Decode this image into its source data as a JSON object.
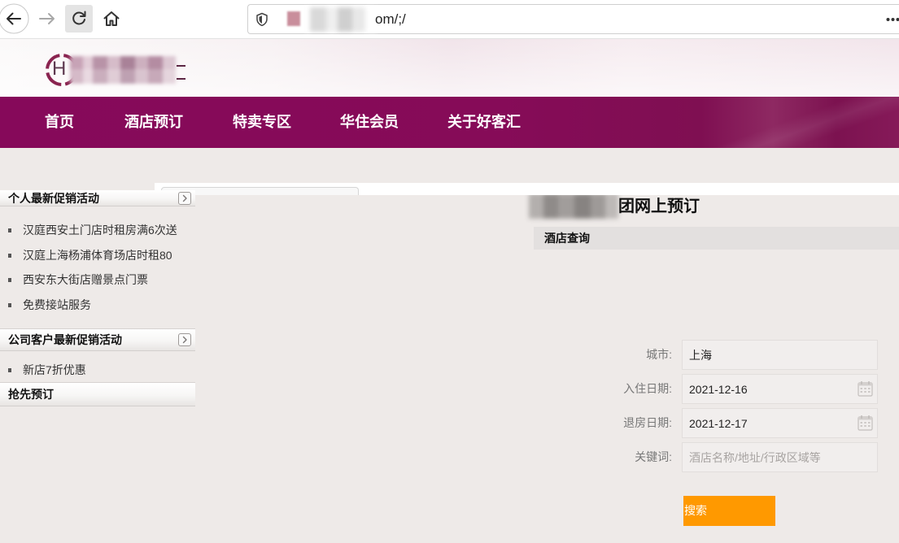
{
  "browser": {
    "url_tail": "om/;/"
  },
  "header": {
    "logo_letter": "H"
  },
  "nav": {
    "items": [
      "首页",
      "酒店预订",
      "特卖专区",
      "华住会员",
      "关于好客汇"
    ]
  },
  "sidebar": {
    "sections": [
      {
        "title": "个人最新促销活动",
        "items": [
          "汉庭西安土门店时租房满6次送",
          "汉庭上海杨浦体育场店时租80",
          "西安东大街店赠景点门票",
          "免费接站服务"
        ]
      },
      {
        "title": "公司客户最新促销活动",
        "items": [
          "新店7折优惠"
        ]
      },
      {
        "title": "抢先预订",
        "items": []
      }
    ]
  },
  "main": {
    "title_visible": "团网上预订",
    "panel_title": "酒店查询",
    "form": {
      "city": {
        "label": "城市:",
        "value": "上海"
      },
      "checkin": {
        "label": "入住日期:",
        "value": "2021-12-16"
      },
      "checkout": {
        "label": "退房日期:",
        "value": "2021-12-17"
      },
      "keyword": {
        "label": "关键词:",
        "placeholder": "酒店名称/地址/行政区域等"
      },
      "search_button": "搜索"
    }
  },
  "icons": {
    "back": "arrow-left-icon",
    "forward": "arrow-right-icon",
    "reload": "reload-icon",
    "home": "home-icon",
    "security": "shield-icon",
    "menu": "more-icon",
    "section_expand": "chevron-right-icon",
    "date_picker": "calendar-icon"
  },
  "colors": {
    "nav_purple": "#86095a",
    "search_button": "#ff9900",
    "page_background": "#eeeae8"
  }
}
